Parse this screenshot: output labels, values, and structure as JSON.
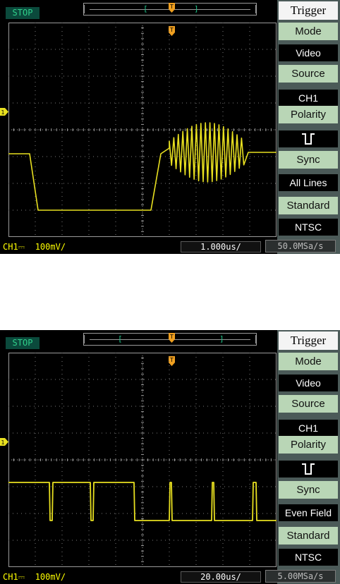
{
  "screens": [
    {
      "status": "STOP",
      "menu": {
        "title": "Trigger",
        "items": [
          {
            "label": "Mode",
            "value": "Video"
          },
          {
            "label": "Source",
            "value": "CH1"
          },
          {
            "label": "Polarity",
            "value": "polarity-negative-icon"
          },
          {
            "label": "Sync",
            "value": "All Lines"
          },
          {
            "label": "Standard",
            "value": "NTSC"
          }
        ]
      },
      "channel": "CH1⎓  100mV/",
      "timebase": "1.000us/",
      "sample_rate": "50.0MSa/s",
      "trigger_marker": "T",
      "channel_marker": "1"
    },
    {
      "status": "STOP",
      "menu": {
        "title": "Trigger",
        "items": [
          {
            "label": "Mode",
            "value": "Video"
          },
          {
            "label": "Source",
            "value": "CH1"
          },
          {
            "label": "Polarity",
            "value": "polarity-negative-icon"
          },
          {
            "label": "Sync",
            "value": "Even Field"
          },
          {
            "label": "Standard",
            "value": "NTSC"
          }
        ]
      },
      "channel": "CH1⎓  100mV/",
      "timebase": "20.00us/",
      "sample_rate": "5.00MSa/s",
      "trigger_marker": "T",
      "channel_marker": "1"
    }
  ],
  "colors": {
    "trace": "#e8e020",
    "grid": "#9a9a9a",
    "menu_label_bg": "#b9d6b6",
    "menu_bg": "#4b5a58",
    "status_text": "#2fd08a",
    "trigger_marker": "#f0a020"
  }
}
